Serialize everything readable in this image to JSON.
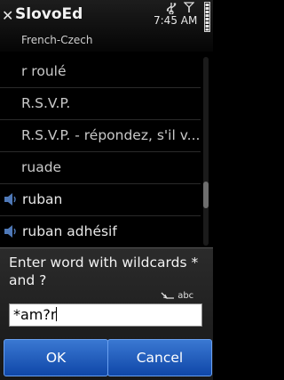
{
  "app": {
    "title": "SlovoEd",
    "subtitle": "French-Czech"
  },
  "status": {
    "time": "7:45 AM"
  },
  "list": {
    "items": [
      {
        "label": "r roulé",
        "audio": false
      },
      {
        "label": "R.S.V.P.",
        "audio": false
      },
      {
        "label": "R.S.V.P. - répondez, s'il v...",
        "audio": false
      },
      {
        "label": "ruade",
        "audio": false
      },
      {
        "label": "ruban",
        "audio": true
      },
      {
        "label": "ruban adhésif",
        "audio": true
      }
    ]
  },
  "dialog": {
    "prompt": "Enter word with wildcards * and ?",
    "input_mode": "abc",
    "input_value": "*am?r",
    "ok_label": "OK",
    "cancel_label": "Cancel"
  },
  "colors": {
    "button": "#1f5cc0",
    "background": "#000000"
  },
  "icons": [
    "close-icon",
    "usb-icon",
    "signal-icon",
    "battery-icon",
    "speaker-icon",
    "input-mode-icon"
  ]
}
